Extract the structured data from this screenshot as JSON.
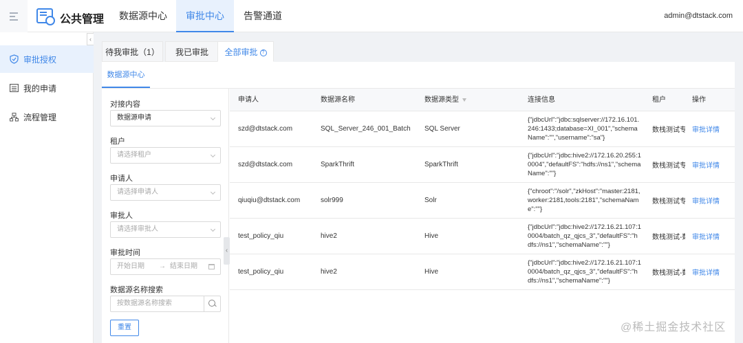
{
  "app": {
    "title": "公共管理",
    "user": "admin@dtstack.com"
  },
  "nav": [
    "数据源中心",
    "审批中心",
    "告警通道"
  ],
  "sidebar": {
    "items": [
      {
        "label": "审批授权",
        "icon": "shield-icon"
      },
      {
        "label": "我的申请",
        "icon": "list-icon"
      },
      {
        "label": "流程管理",
        "icon": "flow-icon"
      }
    ]
  },
  "tabs": [
    "待我审批（1）",
    "我已审批",
    "全部审批"
  ],
  "subtab": "数据源中心",
  "filters": {
    "content_label": "对接内容",
    "content_value": "数据源申请",
    "tenant_label": "租户",
    "tenant_placeholder": "请选择租户",
    "applicant_label": "申请人",
    "applicant_placeholder": "请选择申请人",
    "approver_label": "审批人",
    "approver_placeholder": "请选择审批人",
    "time_label": "审批时间",
    "start_placeholder": "开始日期",
    "date_separator": "→",
    "end_placeholder": "结束日期",
    "search_label": "数据源名称搜索",
    "search_placeholder": "按数据源名称搜索",
    "reset": "重置"
  },
  "table": {
    "columns": [
      "申请人",
      "数据源名称",
      "数据源类型",
      "连接信息",
      "租户",
      "操作"
    ],
    "rows": [
      {
        "applicant": "szd@dtstack.com",
        "name": "SQL_Server_246_001_Batch",
        "type": "SQL Server",
        "conn": "{\"jdbcUrl\":\"jdbc:sqlserver://172.16.101.246:1433;database=XI_001\",\"schemaName\":\"\",\"username\":\"sa\"}",
        "tenant": "数栈测试专",
        "action": "审批详情"
      },
      {
        "applicant": "szd@dtstack.com",
        "name": "SparkThrift",
        "type": "SparkThrift",
        "conn": "{\"jdbcUrl\":\"jdbc:hive2://172.16.20.255:10004\",\"defaultFS\":\"hdfs://ns1\",\"schemaName\":\"\"}",
        "tenant": "数栈测试专",
        "action": "审批详情"
      },
      {
        "applicant": "qiuqiu@dtstack.com",
        "name": "solr999",
        "type": "Solr",
        "conn": "{\"chroot\":\"/solr\",\"zkHost\":\"master:2181,worker:2181,tools:2181\",\"schemaName\":\"\"}",
        "tenant": "数栈测试专",
        "action": "审批详情"
      },
      {
        "applicant": "test_policy_qiu",
        "name": "hive2",
        "type": "Hive",
        "conn": "{\"jdbcUrl\":\"jdbc:hive2://172.16.21.107:10004/batch_qz_qjcs_3\",\"defaultFS\":\"hdfs://ns1\",\"schemaName\":\"\"}",
        "tenant": "数栈测试-数",
        "action": "审批详情"
      },
      {
        "applicant": "test_policy_qiu",
        "name": "hive2",
        "type": "Hive",
        "conn": "{\"jdbcUrl\":\"jdbc:hive2://172.16.21.107:10004/batch_qz_qjcs_3\",\"defaultFS\":\"hdfs://ns1\",\"schemaName\":\"\"}",
        "tenant": "数栈测试-数",
        "action": "审批详情"
      }
    ]
  },
  "watermark": "@稀土掘金技术社区",
  "colors": {
    "accent": "#3f87e8",
    "active_bg": "#e8f1fd"
  }
}
